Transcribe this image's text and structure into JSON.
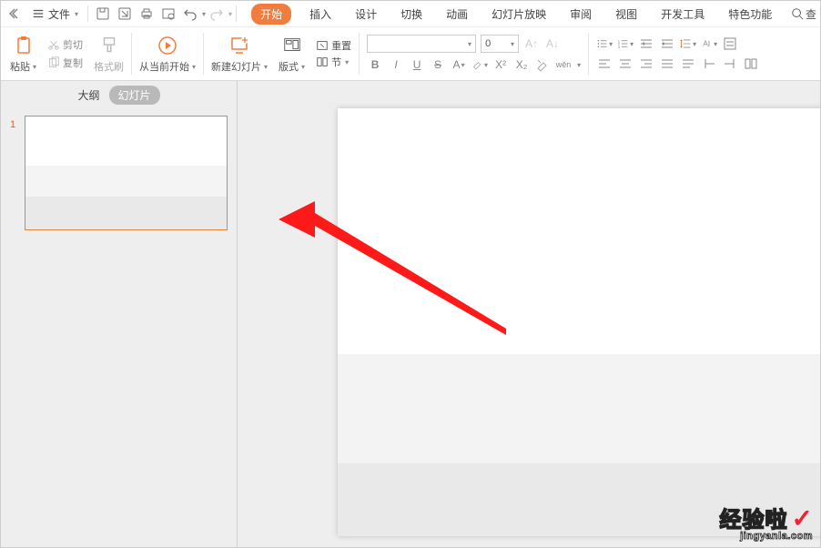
{
  "menubar": {
    "file": "文件",
    "tabs": {
      "start": "开始",
      "insert": "插入",
      "design": "设计",
      "transition": "切换",
      "animation": "动画",
      "slideshow": "幻灯片放映",
      "review": "审阅",
      "view": "视图",
      "devtools": "开发工具",
      "special": "特色功能"
    },
    "search_placeholder": "查"
  },
  "ribbon": {
    "paste": "粘贴",
    "cut": "剪切",
    "copy": "复制",
    "format_painter": "格式刷",
    "from_current": "从当前开始",
    "new_slide": "新建幻灯片",
    "layout": "版式",
    "reset": "重置",
    "section": "节",
    "font_size": "0",
    "wen": "wěn"
  },
  "sidebar": {
    "outline": "大纲",
    "thumbnails": "幻灯片",
    "slide_num": "1"
  },
  "watermark": {
    "main": "经验啦",
    "sub": "jingyanla.com"
  }
}
